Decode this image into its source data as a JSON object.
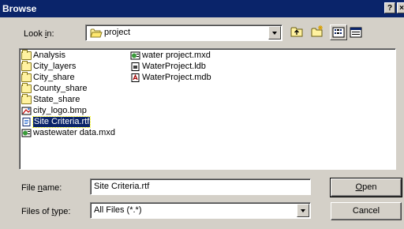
{
  "window": {
    "title": "Browse",
    "help_label": "?",
    "close_label": "×"
  },
  "look_in": {
    "label_pre": "Look ",
    "label_accel": "i",
    "label_post": "n:",
    "value": "project"
  },
  "toolbar": {
    "up_folder": "up-folder-icon",
    "new_folder": "new-folder-icon",
    "list_view": "list-view-icon",
    "details_view": "details-view-icon"
  },
  "files": {
    "column1": [
      {
        "name": "Analysis",
        "icon": "folder-icon"
      },
      {
        "name": "City_layers",
        "icon": "folder-icon"
      },
      {
        "name": "City_share",
        "icon": "folder-icon"
      },
      {
        "name": "County_share",
        "icon": "folder-icon"
      },
      {
        "name": "State_share",
        "icon": "folder-icon"
      },
      {
        "name": "city_logo.bmp",
        "icon": "bitmap-icon"
      },
      {
        "name": "Site Criteria.rtf",
        "icon": "rtf-document-icon",
        "selected": true
      },
      {
        "name": "wastewater data.mxd",
        "icon": "map-document-icon"
      }
    ],
    "column2": [
      {
        "name": "water project.mxd",
        "icon": "map-document-icon"
      },
      {
        "name": "WaterProject.ldb",
        "icon": "lock-file-icon"
      },
      {
        "name": "WaterProject.mdb",
        "icon": "access-database-icon"
      }
    ]
  },
  "file_name": {
    "label_pre": "File ",
    "label_accel": "n",
    "label_post": "ame:",
    "value": "Site Criteria.rtf"
  },
  "file_type": {
    "label_pre": "Files of ",
    "label_accel": "t",
    "label_post": "ype:",
    "value": "All Files (*.*)"
  },
  "buttons": {
    "open_accel": "O",
    "open_rest": "pen",
    "cancel": "Cancel"
  },
  "colors": {
    "title_bar": "#0a246a",
    "dialog_face": "#d4d0c8",
    "selection": "#0a246a",
    "folder": "#fff2a0"
  }
}
